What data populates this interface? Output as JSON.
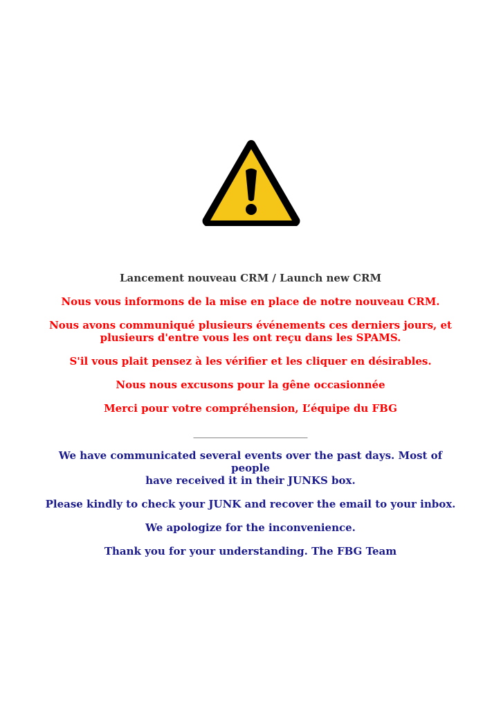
{
  "icon": {
    "name": "warning-icon",
    "fill": "#f5c518",
    "border": "#000000",
    "glyph": "!"
  },
  "colors": {
    "title": "#333333",
    "french": "#ff0000",
    "english": "#1a1a8c"
  },
  "title": "Lancement nouveau CRM / Launch new CRM",
  "french": {
    "line1": "Nous vous informons de la mise en place de notre nouveau CRM.",
    "line2a": "Nous avons communiqué plusieurs événements ces derniers jours, et",
    "line2b": "plusieurs d'entre vous les ont reçu dans les SPAMS.",
    "line3": "S'il vous plait pensez à les vérifier et les cliquer en désirables.",
    "line4": "Nous nous excusons pour la gêne occasionnée",
    "line5": "Merci pour votre compréhension, L’équipe du FBG"
  },
  "separator": "______________________",
  "english": {
    "line1a": "We have communicated several events over the past days. Most of people",
    "line1b": "have received it in their JUNKS box.",
    "line2": "Please kindly to check your JUNK and recover the email to your inbox.",
    "line3": "We apologize for the inconvenience.",
    "line4": "Thank you for your understanding. The FBG Team"
  }
}
